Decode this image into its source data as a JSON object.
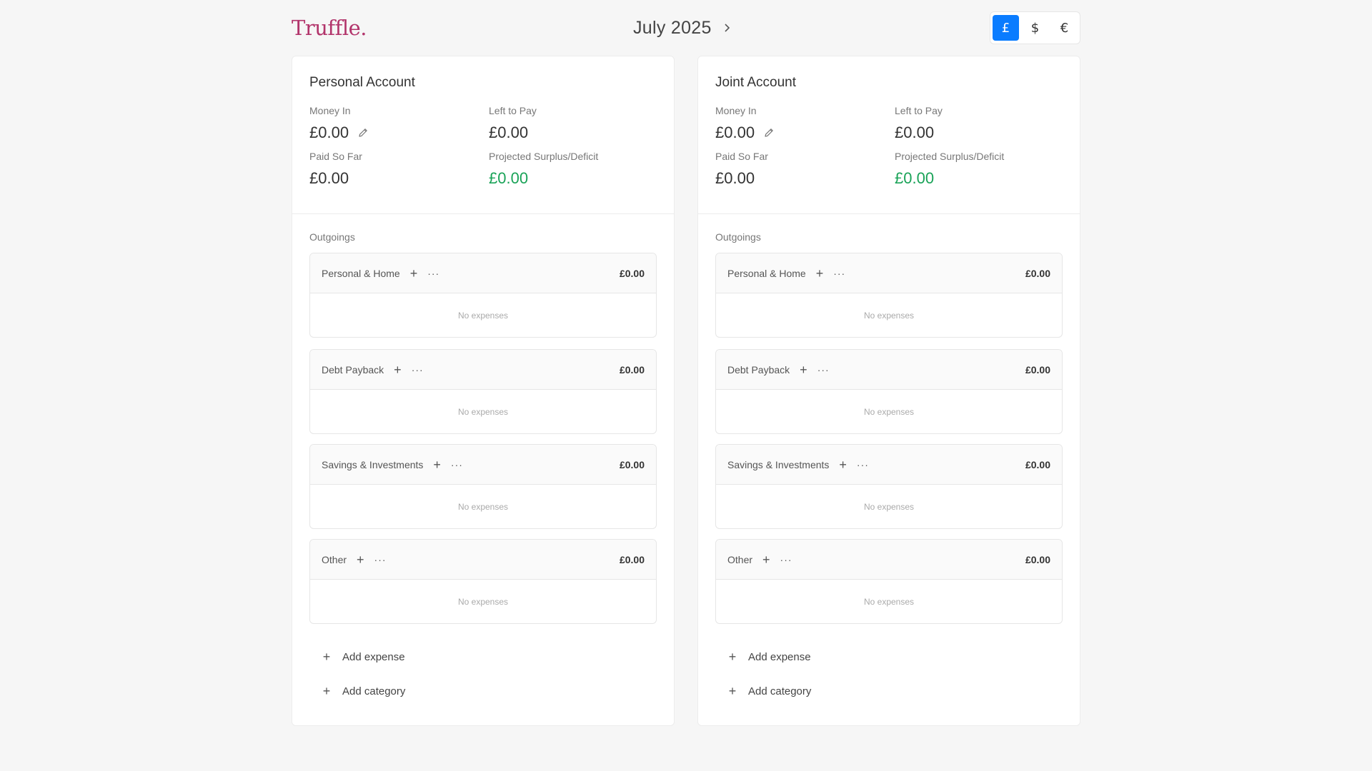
{
  "app": {
    "logo": "Truffle.",
    "month": "July 2025",
    "next_icon": "chevron-right-icon"
  },
  "currency": {
    "options": [
      "£",
      "$",
      "€"
    ],
    "selected": "£",
    "active_color": "#0a7cff"
  },
  "labels": {
    "money_in": "Money In",
    "left_to_pay": "Left to Pay",
    "paid_so_far": "Paid So Far",
    "projected": "Projected Surplus/Deficit",
    "outgoings": "Outgoings",
    "no_expenses": "No expenses",
    "add_expense": "Add expense",
    "add_category": "Add category"
  },
  "colors": {
    "logo": "#b2346b",
    "positive": "#1aa358"
  },
  "accounts": [
    {
      "title": "Personal Account",
      "money_in": "£0.00",
      "left_to_pay": "£0.00",
      "paid_so_far": "£0.00",
      "projected": "£0.00",
      "categories": [
        {
          "name": "Personal & Home",
          "total": "£0.00"
        },
        {
          "name": "Debt Payback",
          "total": "£0.00"
        },
        {
          "name": "Savings & Investments",
          "total": "£0.00"
        },
        {
          "name": "Other",
          "total": "£0.00"
        }
      ]
    },
    {
      "title": "Joint Account",
      "money_in": "£0.00",
      "left_to_pay": "£0.00",
      "paid_so_far": "£0.00",
      "projected": "£0.00",
      "categories": [
        {
          "name": "Personal & Home",
          "total": "£0.00"
        },
        {
          "name": "Debt Payback",
          "total": "£0.00"
        },
        {
          "name": "Savings & Investments",
          "total": "£0.00"
        },
        {
          "name": "Other",
          "total": "£0.00"
        }
      ]
    }
  ]
}
